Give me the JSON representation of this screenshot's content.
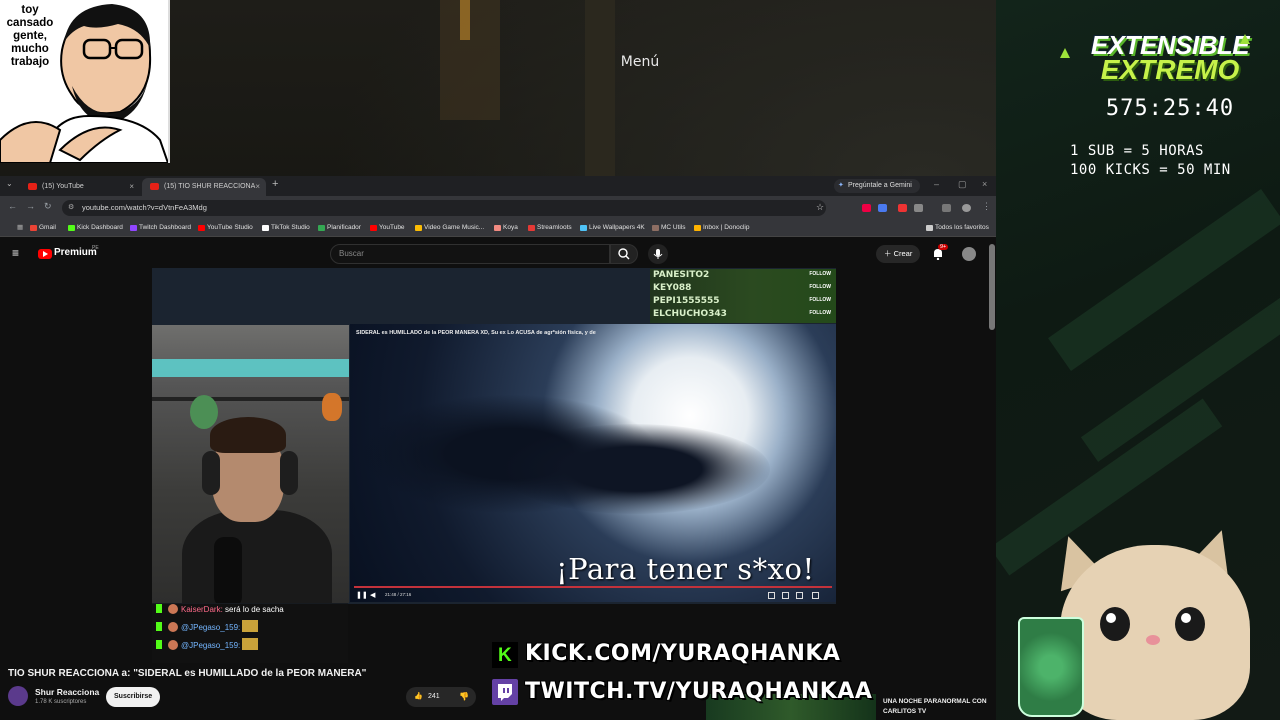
{
  "overlay": {
    "meme_text": "toy cansado gente, mucho trabajo",
    "menu_label": "Menú",
    "event_title_line1": "EXTENSIBLE",
    "event_title_line2": "EXTREMO",
    "timer": "575:25:40",
    "rules": [
      "1 SUB = 5 HORAS",
      "100 KICKS = 50 MIN"
    ],
    "kick_url": "KICK.COM/YURAQHANKA",
    "twitch_url": "TWITCH.TV/YURAQHANKAA",
    "follows": [
      {
        "name": "PANESITO2",
        "tag": "FOLLOW"
      },
      {
        "name": "KEY088",
        "tag": "FOLLOW"
      },
      {
        "name": "PEPI1555555",
        "tag": "FOLLOW"
      },
      {
        "name": "ELCHUCHO343",
        "tag": "FOLLOW"
      }
    ],
    "chat": [
      {
        "user": "KaiserDark:",
        "message": "será lo de sacha"
      },
      {
        "user": "@JPegaso_159:",
        "message": ""
      },
      {
        "user": "@JPegaso_159:",
        "message": ""
      }
    ]
  },
  "browser": {
    "tabs": [
      {
        "label": "(15) YouTube",
        "close": "×"
      },
      {
        "label": "(15) TIO SHUR REACCIONA",
        "close": "×"
      }
    ],
    "new_tab": "+",
    "gemini_label": "Pregúntale a Gemini",
    "window_controls": [
      "–",
      "▢",
      "×"
    ],
    "url": "youtube.com/watch?v=dVtnFeA3Mdg",
    "bookmarks": [
      {
        "label": "Gmail",
        "color": "#ea4335"
      },
      {
        "label": "Kick Dashboard",
        "color": "#53fc18"
      },
      {
        "label": "Twitch Dashboard",
        "color": "#9146ff"
      },
      {
        "label": "YouTube Studio",
        "color": "#ff0000"
      },
      {
        "label": "TikTok Studio",
        "color": "#ffffff"
      },
      {
        "label": "Planificador",
        "color": "#34a853"
      },
      {
        "label": "YouTube",
        "color": "#ff0000"
      },
      {
        "label": "Video Game Music...",
        "color": "#fbbc04"
      },
      {
        "label": "Koya",
        "color": "#f28b82"
      },
      {
        "label": "Streamloots",
        "color": "#e53935"
      },
      {
        "label": "Live Wallpapers 4K",
        "color": "#4fc3f7"
      },
      {
        "label": "MC Utils",
        "color": "#8d6e63"
      },
      {
        "label": "Inbox | Donoclip",
        "color": "#ffb300"
      }
    ],
    "bookmarks_all": "Todos los favoritos"
  },
  "youtube": {
    "brand": "Premium",
    "region": "PE",
    "search_placeholder": "Buscar",
    "create_label": "Crear",
    "notif_badge": "9+",
    "video_overlay_title": "SIDERAL es HUMILLADO de la PEOR MANERA  XD, Su ex Lo ACUSA de agr*sión física, y de",
    "subtitle": "¡Para tener s*xo!",
    "time_display": "21:48 / 27:16",
    "video_heading": "TIO SHUR REACCIONA a: \"SIDERAL es HUMILLADO de la PEOR MANERA\"",
    "channel_name": "Shur Reacciona",
    "channel_subs": "1.78 K suscriptores",
    "subscribe_label": "Suscribirse",
    "likes": "241",
    "recommended_title": "UNA NOCHE PARANORMAL CON CARLITOS TV"
  },
  "colors": {
    "kick_green": "#53fc18",
    "twitch_purple": "#6441a5",
    "youtube_red": "#ff0000",
    "event_green": "#c6f24a"
  }
}
